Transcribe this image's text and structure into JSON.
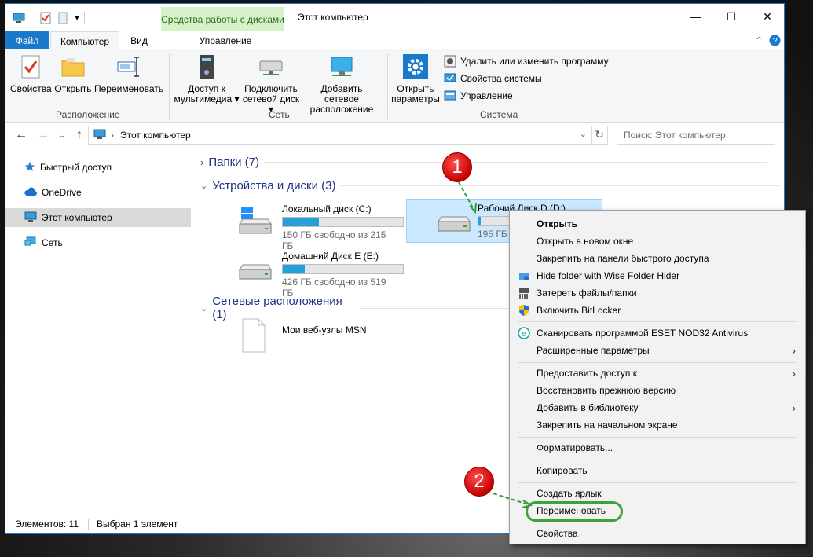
{
  "titlebar": {
    "contextual_tab": "Средства работы с дисками",
    "title": "Этот компьютер",
    "minimize": "—",
    "maximize": "☐",
    "close": "✕"
  },
  "ribbon_tabs": {
    "file": "Файл",
    "computer": "Компьютер",
    "view": "Вид",
    "manage": "Управление"
  },
  "ribbon": {
    "properties": "Свойства",
    "open": "Открыть",
    "rename": "Переименовать",
    "group_location": "Расположение",
    "media_access_1": "Доступ к",
    "media_access_2": "мультимедиа",
    "map_drive_1": "Подключить",
    "map_drive_2": "сетевой диск",
    "add_network_1": "Добавить сетевое",
    "add_network_2": "расположение",
    "group_network": "Сеть",
    "open_settings_1": "Открыть",
    "open_settings_2": "параметры",
    "uninstall": "Удалить или изменить программу",
    "system_props": "Свойства системы",
    "manage": "Управление",
    "group_system": "Система"
  },
  "address": {
    "path": "Этот компьютер",
    "search_placeholder": "Поиск: Этот компьютер"
  },
  "nav": {
    "items": [
      {
        "label": "Быстрый доступ",
        "icon": "star-icon"
      },
      {
        "label": "OneDrive",
        "icon": "cloud-icon"
      },
      {
        "label": "Этот компьютер",
        "icon": "computer-icon",
        "selected": true
      },
      {
        "label": "Сеть",
        "icon": "network-icon"
      }
    ]
  },
  "content": {
    "folders_group": "Папки (7)",
    "devices_group": "Устройства и диски (3)",
    "network_group": "Сетевые расположения (1)",
    "drives": [
      {
        "name": "Локальный диск (C:)",
        "free": "150 ГБ свободно из 215 ГБ",
        "used_fraction": 0.3
      },
      {
        "name": "Рабочий Диск D (D:)",
        "free": "195 ГБ",
        "used_fraction": 0.06
      },
      {
        "name": "Домашний Диск E (E:)",
        "free": "426 ГБ свободно из 519 ГБ",
        "used_fraction": 0.18
      }
    ],
    "network_item": "Мои веб-узлы MSN"
  },
  "status": {
    "items": "Элементов: 11",
    "selected": "Выбран 1 элемент"
  },
  "context_menu": {
    "open": "Открыть",
    "open_new_window": "Открыть в новом окне",
    "pin_quick": "Закрепить на панели быстрого доступа",
    "wise": "Hide folder with Wise Folder Hider",
    "shred": "Затереть файлы/папки",
    "bitlocker": "Включить BitLocker",
    "eset": "Сканировать программой ESET NOD32 Antivirus",
    "advanced": "Расширенные параметры",
    "share": "Предоставить доступ к",
    "restore": "Восстановить прежнюю версию",
    "library": "Добавить в библиотеку",
    "pin_start": "Закрепить на начальном экране",
    "format": "Форматировать...",
    "copy": "Копировать",
    "shortcut": "Создать ярлык",
    "rename": "Переименовать",
    "properties": "Свойства"
  },
  "annotations": {
    "step1": "1",
    "step2": "2"
  }
}
